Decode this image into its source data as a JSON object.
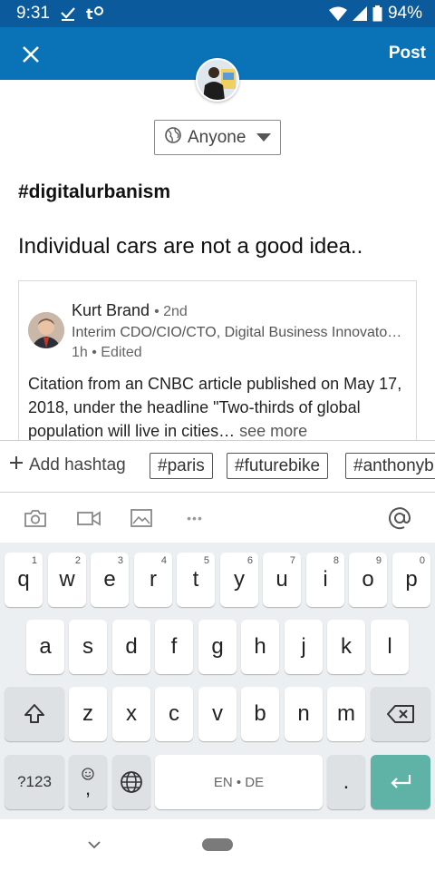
{
  "status_bar": {
    "time": "9:31",
    "battery": "94%"
  },
  "app_bar": {
    "post_label": "Post"
  },
  "composer": {
    "visibility": "Anyone",
    "hashtag_title": "#digitalurbanism",
    "text": "Individual cars are not a good idea.."
  },
  "shared_post": {
    "author": "Kurt Brand",
    "degree": "• 2nd",
    "headline": "Interim CDO/CIO/CTO, Digital Business Innovato…",
    "meta": "1h • Edited",
    "body": "Citation from an CNBC article published on May 17, 2018, under the headline \"Two-thirds of global population will live in cities…",
    "see_more": "see more"
  },
  "hashtags": {
    "add_label": "Add hashtag",
    "chips": [
      "#paris",
      "#futurebike",
      "#anthonyb"
    ]
  },
  "toolbar": {
    "more": "•••"
  },
  "keyboard": {
    "row1": [
      {
        "k": "q",
        "h": "1"
      },
      {
        "k": "w",
        "h": "2"
      },
      {
        "k": "e",
        "h": "3"
      },
      {
        "k": "r",
        "h": "4"
      },
      {
        "k": "t",
        "h": "5"
      },
      {
        "k": "y",
        "h": "6"
      },
      {
        "k": "u",
        "h": "7"
      },
      {
        "k": "i",
        "h": "8"
      },
      {
        "k": "o",
        "h": "9"
      },
      {
        "k": "p",
        "h": "0"
      }
    ],
    "row2": [
      "a",
      "s",
      "d",
      "f",
      "g",
      "h",
      "j",
      "k",
      "l"
    ],
    "row3": [
      "z",
      "x",
      "c",
      "v",
      "b",
      "n",
      "m"
    ],
    "symbols": "?123",
    "comma": ",",
    "space": "EN • DE",
    "period": "."
  }
}
